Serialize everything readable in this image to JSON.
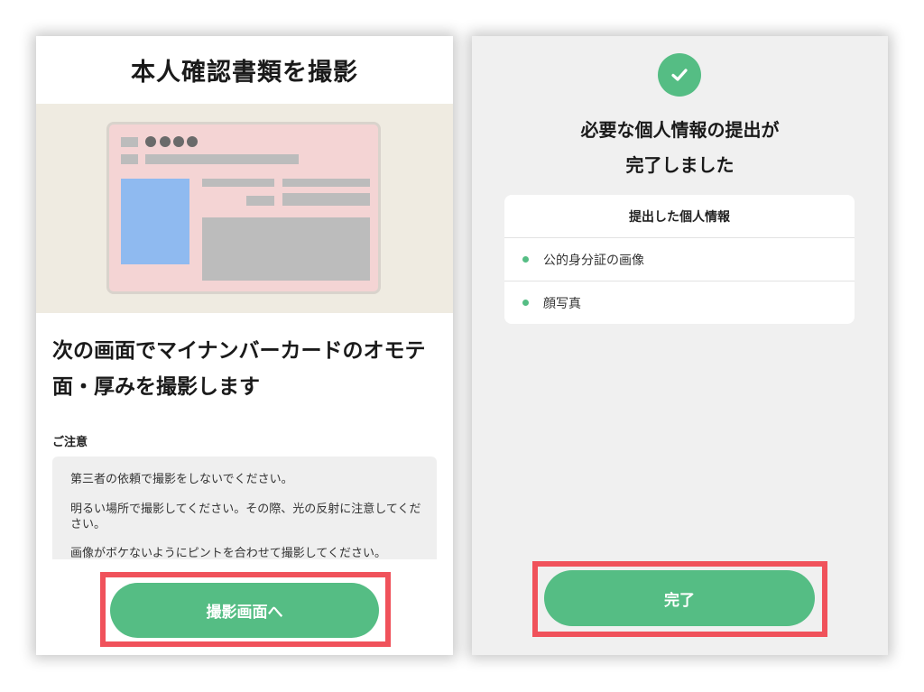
{
  "capture_screen": {
    "title": "本人確認書類を撮影",
    "instruction_line1": "次の画面でマイナンバーカードのオモテ",
    "instruction_line2": "面・厚みを撮影します",
    "notice_title": "ご注意",
    "notices": [
      "第三者の依頼で撮影をしないでください。",
      "明るい場所で撮影してください。その際、光の反射に注意してください。",
      "画像がボケないようにピントを合わせて撮影してください。"
    ],
    "button_label": "撮影画面へ"
  },
  "complete_screen": {
    "message_line1": "必要な個人情報の提出が",
    "message_line2": "完了しました",
    "card_header": "提出した個人情報",
    "items": [
      "公的身分証の画像",
      "顔写真"
    ],
    "button_label": "完了"
  },
  "colors": {
    "accent_green": "#55bd84",
    "highlight_red": "#f0525b",
    "card_pink": "#f4d4d4",
    "photo_blue": "#8fbaf0"
  },
  "icons": [
    "id-card-illustration",
    "check-icon",
    "bullet-icon"
  ]
}
